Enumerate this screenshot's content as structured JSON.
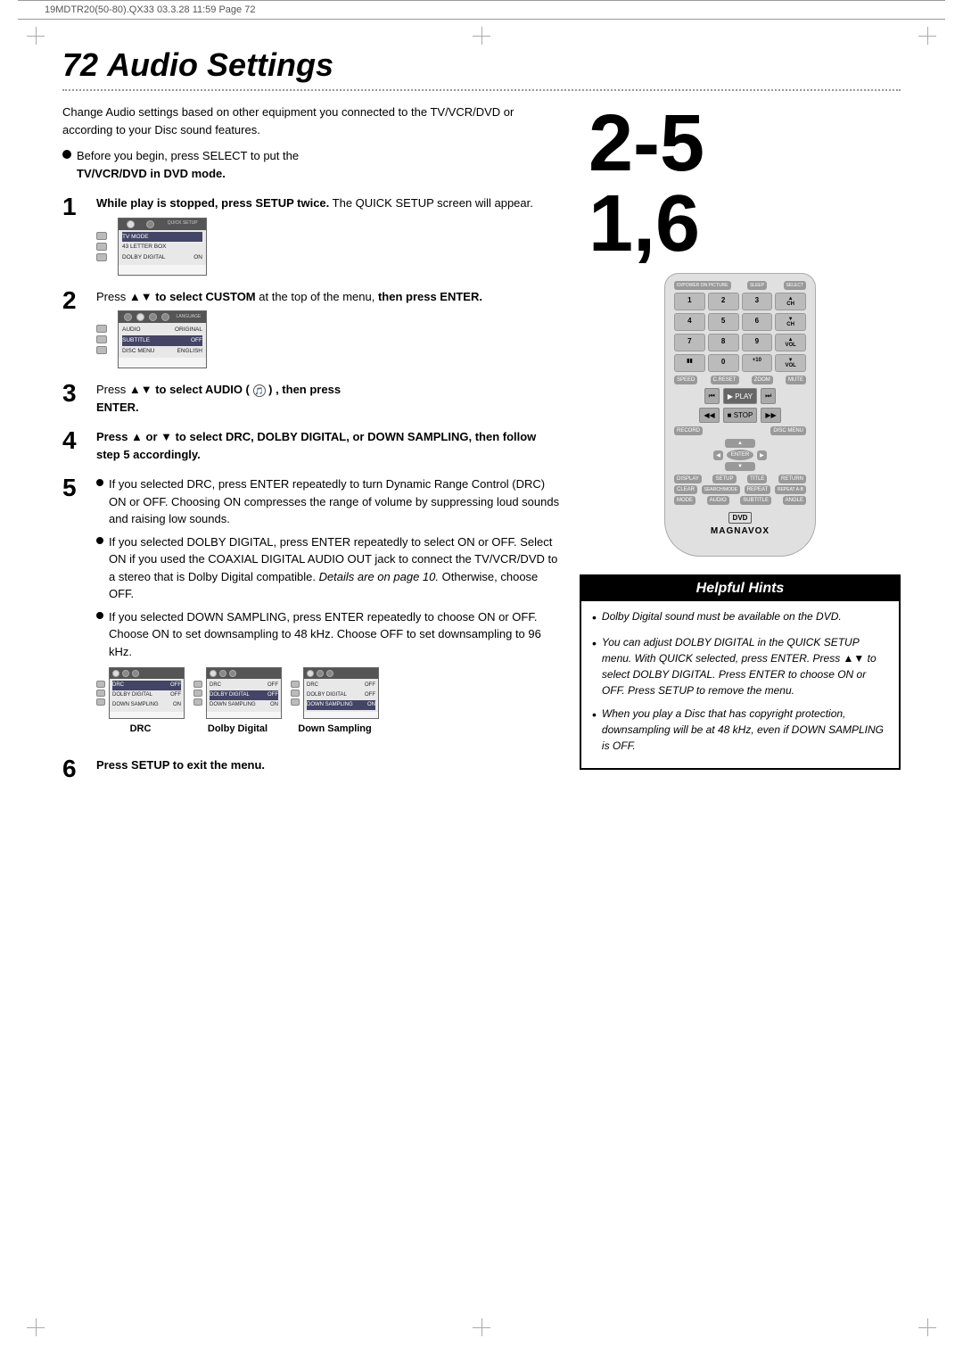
{
  "header": {
    "left_text": "19MDTR20(50-80).QX33   03.3.28 11:59   Page 72",
    "right_text": ""
  },
  "page": {
    "number": "72",
    "title": "Audio Settings"
  },
  "intro": {
    "paragraph": "Change Audio settings based on other equipment you connected to the TV/VCR/DVD or according to your Disc sound features.",
    "bullet_bold_before": "Before you begin, press SELECT to put the",
    "bullet_bold_after": "TV/VCR/DVD in DVD mode."
  },
  "steps": [
    {
      "number": "1",
      "bold_text": "While play is stopped, press SETUP twice.",
      "text": " The QUICK SETUP screen will appear."
    },
    {
      "number": "2",
      "bold_text": "Press ▲▼ to select CUSTOM",
      "text": " at the top of the menu, then press ENTER."
    },
    {
      "number": "3",
      "bold_text": "Press ▲▼ to select AUDIO (  ) , then press",
      "text": "ENTER."
    },
    {
      "number": "4",
      "bold_text": "Press ▲ or ▼ to select DRC, DOLBY DIGITAL, or DOWN SAMPLING, then follow step 5 accordingly."
    },
    {
      "number": "5",
      "bullets": [
        "If you selected DRC, press ENTER repeatedly to turn Dynamic Range Control (DRC) ON or OFF. Choosing ON compresses the range of volume by suppressing loud sounds and raising low sounds.",
        "If you selected DOLBY DIGITAL, press ENTER repeatedly to select ON or OFF. Select ON if you used the COAXIAL DIGITAL AUDIO OUT jack to connect the TV/VCR/DVD to a stereo that is Dolby Digital compatible. Details are on page 10. Otherwise, choose OFF.",
        "If you selected DOWN SAMPLING, press ENTER repeatedly to choose ON or OFF. Choose ON to set downsampling to 48 kHz. Choose OFF to set downsampling to 96 kHz."
      ]
    },
    {
      "number": "6",
      "bold_text": "Press SETUP to exit the menu."
    }
  ],
  "screen_labels": {
    "drc": "DRC",
    "dolby_digital": "Dolby Digital",
    "down_sampling": "Down Sampling"
  },
  "large_numbers": {
    "line1": "2-5",
    "line2": "1,6"
  },
  "remote": {
    "brand": "MAGNAVOX",
    "dvd": "dvd"
  },
  "helpful_hints": {
    "title": "Helpful Hints",
    "items": [
      "Dolby Digital sound must be available on the DVD.",
      "You can adjust DOLBY DIGITAL in the QUICK SETUP menu. With QUICK selected, press ENTER. Press ▲▼ to select DOLBY DIGITAL. Press ENTER to choose ON or OFF. Press SETUP to remove the menu.",
      "When you play a Disc that has copyright protection, downsampling will be at 48 kHz, even if DOWN SAMPLING is OFF."
    ]
  },
  "screen1": {
    "title": "QUICK SETUP",
    "rows": [
      {
        "label": "TV MODE",
        "value": ""
      },
      {
        "label": "43 LETTER BOX",
        "value": ""
      },
      {
        "label": "DOLBY DIGITAL",
        "value": "ON"
      }
    ]
  },
  "screen2": {
    "title": "LANGUAGE",
    "rows": [
      {
        "label": "AUDIO",
        "value": "ORIGINAL",
        "selected": false
      },
      {
        "label": "SUBTITLE",
        "value": "OFF",
        "selected": false
      },
      {
        "label": "DISC MENU",
        "value": "ENGLISH",
        "selected": false
      }
    ]
  }
}
